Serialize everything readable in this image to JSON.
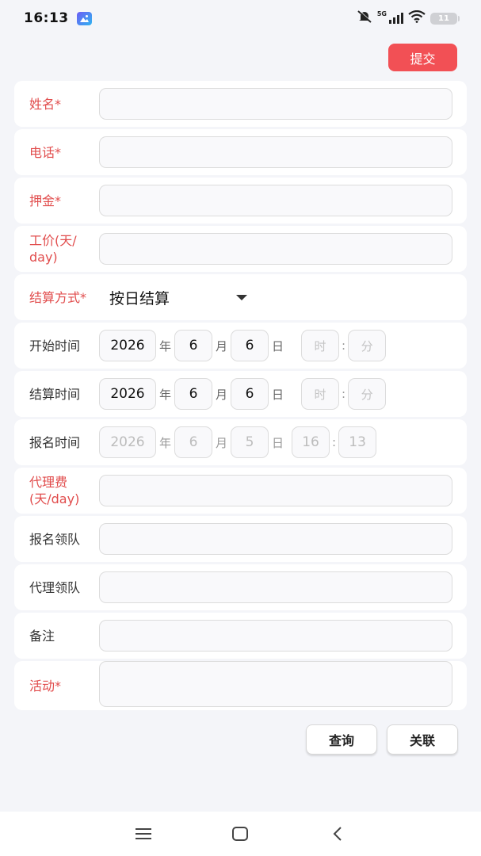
{
  "status_bar": {
    "time": "16:13",
    "network": "5G",
    "battery": "11"
  },
  "toolbar": {
    "submit_label": "提交"
  },
  "form": {
    "name": {
      "label": "姓名*"
    },
    "phone": {
      "label": "电话*"
    },
    "deposit": {
      "label": "押金*"
    },
    "wage": {
      "label_line1": "工价(天/",
      "label_line2": "day)"
    },
    "settlement": {
      "label": "结算方式*",
      "value": "按日结算"
    },
    "start_time": {
      "label": "开始时间",
      "year": "2026",
      "month": "6",
      "day": "6",
      "hour_placeholder": "时",
      "minute_placeholder": "分"
    },
    "settle_time": {
      "label": "结算时间",
      "year": "2026",
      "month": "6",
      "day": "6",
      "hour_placeholder": "时",
      "minute_placeholder": "分"
    },
    "signup_time": {
      "label": "报名时间",
      "year": "2026",
      "month": "6",
      "day": "5",
      "hour": "16",
      "minute": "13"
    },
    "agent_fee": {
      "label_line1": "代理费",
      "label_line2": "(天/day)"
    },
    "signup_leader": {
      "label": "报名领队"
    },
    "agent_leader": {
      "label": "代理领队"
    },
    "remark": {
      "label": "备注"
    },
    "activity": {
      "label": "活动*"
    },
    "units": {
      "year": "年",
      "month": "月",
      "day": "日",
      "colon": ":"
    }
  },
  "actions": {
    "query_label": "查询",
    "link_label": "关联"
  },
  "colors": {
    "accent": "#f25055",
    "required_label": "#e14c4c"
  },
  "icons": {
    "nav": [
      "menu-icon",
      "home-icon",
      "back-icon"
    ]
  }
}
